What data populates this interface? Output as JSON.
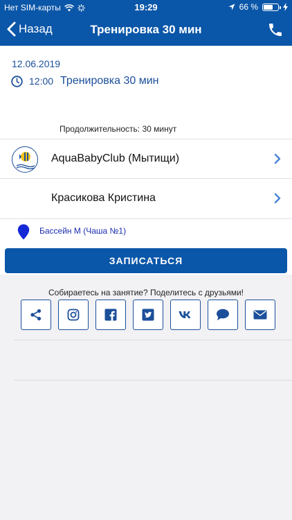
{
  "status_bar": {
    "carrier": "Нет SIM-карты",
    "time": "19:29",
    "battery": "66 %",
    "battery_level": 0.66,
    "icons": [
      "wifi-icon",
      "activity-spinner-icon",
      "location-arrow-icon",
      "battery-icon",
      "charging-icon"
    ]
  },
  "nav": {
    "back_label": "Назад",
    "title": "Тренировка 30 мин",
    "phone_icon": "phone-icon"
  },
  "event": {
    "date": "12.06.2019",
    "time": "12:00",
    "title": "Тренировка 30 мин",
    "duration": "Продолжительность: 30 минут"
  },
  "club": {
    "name": "AquaBabyClub (Мытищи)",
    "logo_text": "AQUA BABY CLUB"
  },
  "trainer": {
    "name": "Красикова  Кристина"
  },
  "location": {
    "name": "Бассейн М (Чаша №1)"
  },
  "signup_label": "ЗАПИСАТЬСЯ",
  "share": {
    "text": "Собираетесь на занятие? Поделитесь с друзьями!",
    "buttons": [
      "share-icon",
      "instagram-icon",
      "facebook-icon",
      "twitter-icon",
      "vk-icon",
      "message-icon",
      "mail-icon"
    ]
  },
  "colors": {
    "brand": "#0a56a8",
    "text_blue": "#1b4f9a",
    "chevron": "#4a86d6"
  }
}
